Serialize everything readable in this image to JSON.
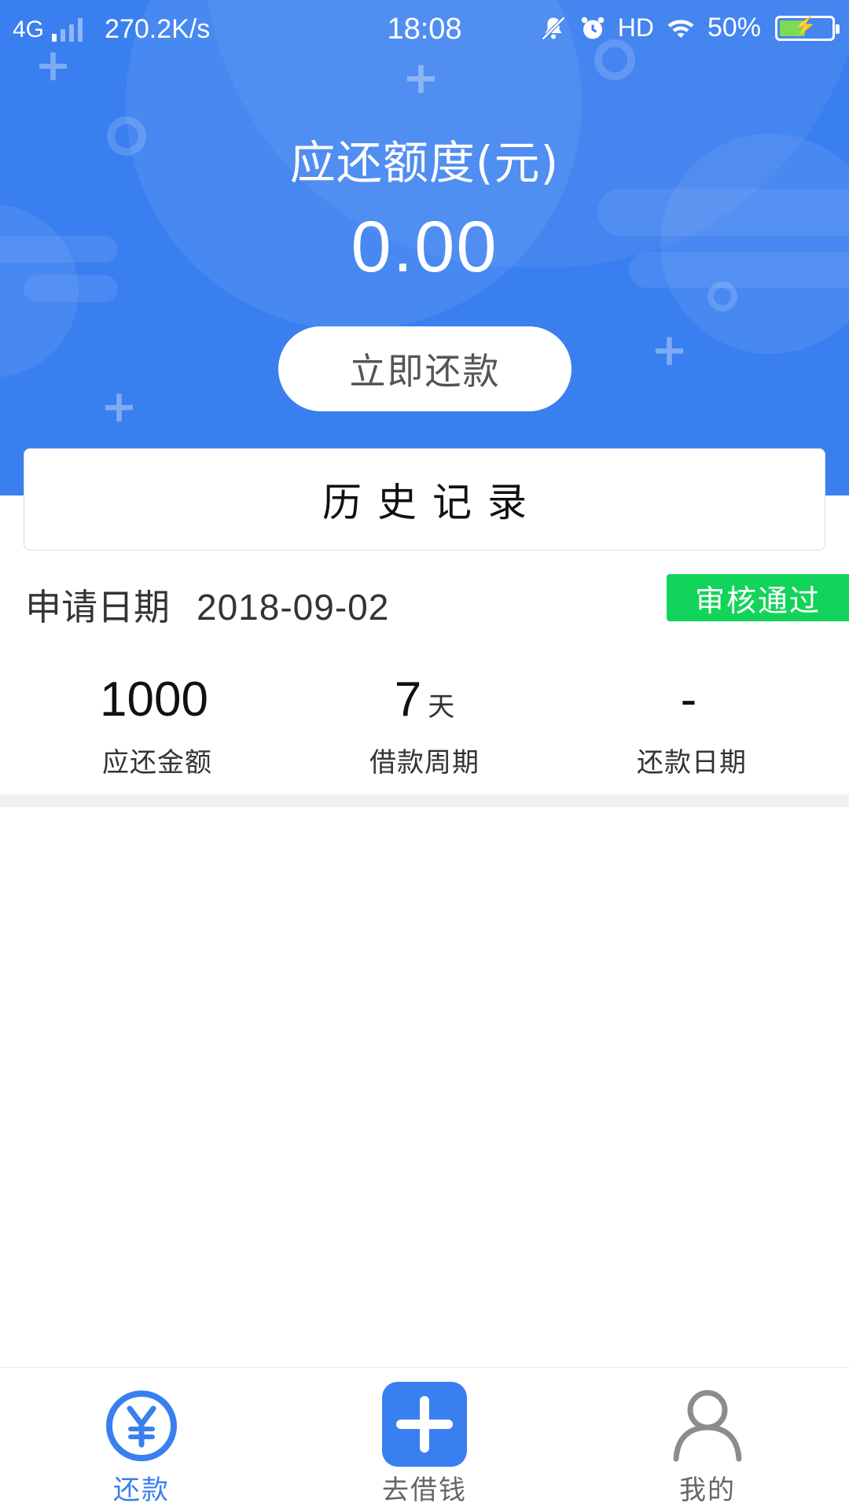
{
  "status_bar": {
    "network": "4G",
    "speed": "270.2K/s",
    "time": "18:08",
    "hd": "HD",
    "battery": "50%",
    "battery_level": 0.5
  },
  "header": {
    "due_label": "应还额度(元)",
    "due_amount": "0.00",
    "repay_button": "立即还款",
    "bg_color": "#3a7ff0"
  },
  "history": {
    "title": "历史记录"
  },
  "record": {
    "date_label": "申请日期",
    "date_value": "2018-09-02",
    "status": "审核通过",
    "status_color": "#13d45a",
    "stats": [
      {
        "value": "1000",
        "unit": "",
        "label": "应还金额"
      },
      {
        "value": "7",
        "unit": "天",
        "label": "借款周期"
      },
      {
        "value": "-",
        "unit": "",
        "label": "还款日期"
      }
    ]
  },
  "nav": {
    "items": [
      {
        "label": "还款",
        "icon": "yen-circle-icon",
        "active": true
      },
      {
        "label": "去借钱",
        "icon": "plus-square-icon",
        "active": false
      },
      {
        "label": "我的",
        "icon": "user-icon",
        "active": false
      }
    ],
    "accent": "#3a7ff0"
  }
}
